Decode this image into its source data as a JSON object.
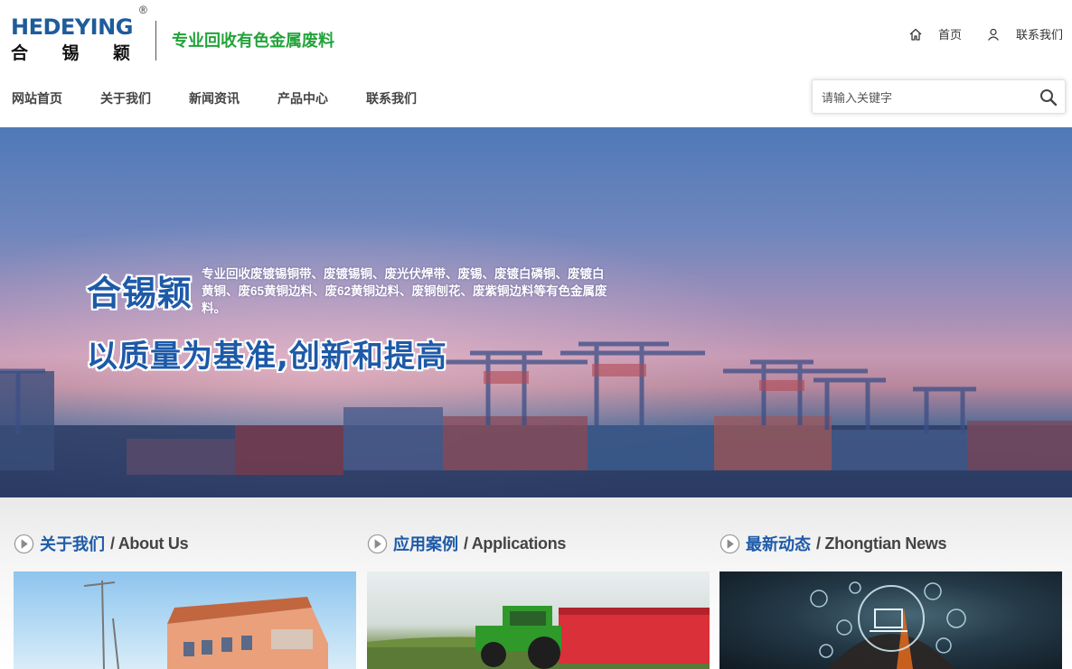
{
  "header": {
    "logo_en": "HEDEYING",
    "logo_reg": "®",
    "logo_cn": [
      "合",
      "锡",
      "颖"
    ],
    "slogan": "专业回收有色金属废料",
    "top_links": [
      {
        "label": "首页",
        "icon": "home-icon"
      },
      {
        "label": "联系我们",
        "icon": "user-icon"
      }
    ]
  },
  "nav": {
    "items": [
      "网站首页",
      "关于我们",
      "新闻资讯",
      "产品中心",
      "联系我们"
    ]
  },
  "search": {
    "placeholder": "请输入关键字",
    "icon": "search-icon"
  },
  "banner": {
    "brand": "合锡颖",
    "description": "专业回收废镀锡铜带、废镀锡铜、废光伏焊带、废锡、废镀白磷铜、废镀白黄铜、废65黄铜边料、废62黄铜边料、废铜刨花、废紫铜边料等有色金属废料。",
    "tagline": "以质量为基准,创新和提高"
  },
  "sections": [
    {
      "title_cn": "关于我们",
      "title_en": "/ About Us",
      "image": "factory-building-photo"
    },
    {
      "title_cn": "应用案例",
      "title_en": "/ Applications",
      "image": "tractor-trailer-photo"
    },
    {
      "title_cn": "最新动态",
      "title_en": "/ Zhongtian News",
      "image": "technology-icons-photo"
    }
  ],
  "colors": {
    "brand_blue": "#1d5aa8",
    "slogan_green": "#22a33a",
    "nav_text": "#444444"
  }
}
